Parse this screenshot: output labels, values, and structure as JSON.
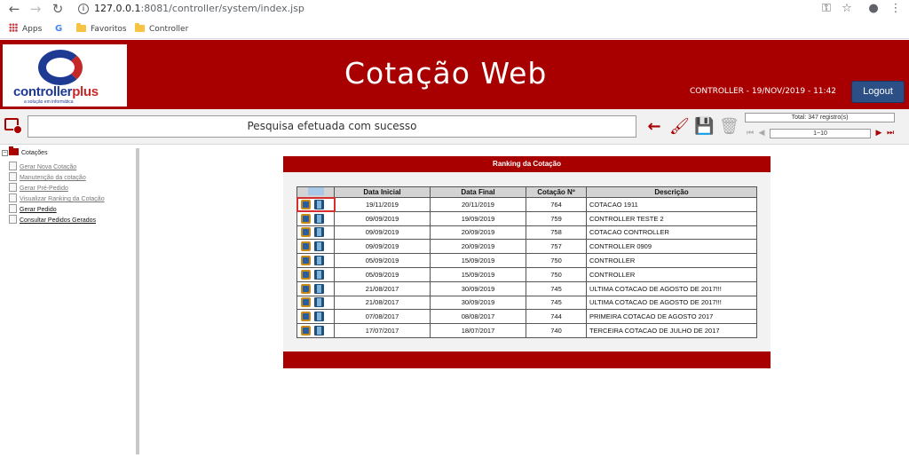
{
  "browser": {
    "url_host": "127.0.0.1",
    "url_rest": ":8081/controller/system/index.jsp",
    "bookmarks": [
      {
        "label": "Apps"
      },
      {
        "label": ""
      },
      {
        "label": "Favoritos"
      },
      {
        "label": "Controller"
      }
    ]
  },
  "header": {
    "logo_main": "controller",
    "logo_plus": "plus",
    "logo_sub": "a solução em informática",
    "title": "Cotação Web",
    "user_info": "CONTROLLER - 19/NOV/2019 - 11:42",
    "logout_label": "Logout"
  },
  "toolbar": {
    "message": "Pesquisa efetuada com sucesso",
    "total_label": "Total: 347 registro(s)",
    "page_range": "1~10",
    "icons": [
      "back-arrow-icon",
      "clear-brush-icon",
      "save-icon",
      "delete-icon"
    ]
  },
  "sidebar": {
    "root_label": "Cotações",
    "items": [
      {
        "label": "Gerar Nova Cotação"
      },
      {
        "label": "Manutenção da cotação"
      },
      {
        "label": "Gerar Pré-Pedido"
      },
      {
        "label": "Visualizar Ranking da Cotação"
      },
      {
        "label": "Gerar Pedido"
      },
      {
        "label": "Consultar Pedidos Gerados"
      }
    ]
  },
  "panel": {
    "title": "Ranking da Cotação",
    "columns": [
      "",
      "Data Inicial",
      "Data Final",
      "Cotação Nº",
      "Descrição"
    ],
    "rows": [
      {
        "data_inicial": "19/11/2019",
        "data_final": "20/11/2019",
        "numero": "764",
        "descricao": "COTACAO 1911"
      },
      {
        "data_inicial": "09/09/2019",
        "data_final": "19/09/2019",
        "numero": "759",
        "descricao": "CONTROLLER TESTE 2"
      },
      {
        "data_inicial": "09/09/2019",
        "data_final": "20/09/2019",
        "numero": "758",
        "descricao": "COTACAO CONTROLLER"
      },
      {
        "data_inicial": "09/09/2019",
        "data_final": "20/09/2019",
        "numero": "757",
        "descricao": "CONTROLLER 0909"
      },
      {
        "data_inicial": "05/09/2019",
        "data_final": "15/09/2019",
        "numero": "750",
        "descricao": "CONTROLLER"
      },
      {
        "data_inicial": "05/09/2019",
        "data_final": "15/09/2019",
        "numero": "750",
        "descricao": "CONTROLLER"
      },
      {
        "data_inicial": "21/08/2017",
        "data_final": "30/09/2019",
        "numero": "745",
        "descricao": "ULTIMA COTACAO DE AGOSTO DE 2017!!!"
      },
      {
        "data_inicial": "21/08/2017",
        "data_final": "30/09/2019",
        "numero": "745",
        "descricao": "ULTIMA COTACAO DE AGOSTO DE 2017!!!"
      },
      {
        "data_inicial": "07/08/2017",
        "data_final": "08/08/2017",
        "numero": "744",
        "descricao": "PRIMEIRA COTACAO DE AGOSTO 2017"
      },
      {
        "data_inicial": "17/07/2017",
        "data_final": "18/07/2017",
        "numero": "740",
        "descricao": "TERCEIRA COTACAO DE JULHO DE 2017"
      }
    ]
  },
  "colors": {
    "brand_red": "#a80000",
    "logout_blue": "#2c4f85",
    "highlight": "#d32f2f"
  }
}
